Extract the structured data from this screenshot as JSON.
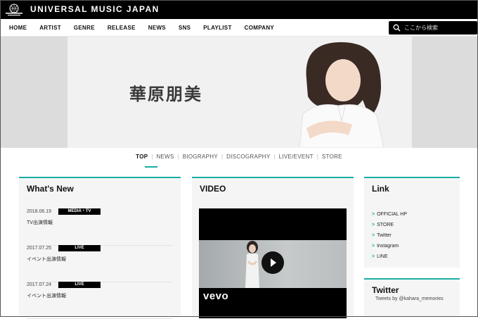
{
  "brand": {
    "name": "UNIVERSAL MUSIC JAPAN",
    "logo_text": "UNIVERSAL"
  },
  "nav": {
    "items": [
      {
        "label": "HOME"
      },
      {
        "label": "ARTIST"
      },
      {
        "label": "GENRE"
      },
      {
        "label": "RELEASE"
      },
      {
        "label": "NEWS"
      },
      {
        "label": "SNS"
      },
      {
        "label": "PLAYLIST"
      },
      {
        "label": "COMPANY"
      }
    ]
  },
  "search": {
    "placeholder": "ここから検索",
    "icon": "search-icon"
  },
  "hero": {
    "artist_name": "華原朋美"
  },
  "subnav": {
    "items": [
      {
        "label": "TOP"
      },
      {
        "label": "NEWS"
      },
      {
        "label": "BIOGRAPHY"
      },
      {
        "label": "DISCOGRAPHY"
      },
      {
        "label": "LIVE/EVENT"
      },
      {
        "label": "STORE"
      }
    ],
    "active": "TOP"
  },
  "whats_new": {
    "title": "What's New",
    "items": [
      {
        "date": "2018.06.19",
        "badge": "MEDIA・TV",
        "title": "TV出演情報"
      },
      {
        "date": "2017.07.25",
        "badge": "LIVE",
        "title": "イベント出演情報"
      },
      {
        "date": "2017.07.24",
        "badge": "LIVE",
        "title": "イベント出演情報"
      }
    ]
  },
  "video": {
    "title": "VIDEO",
    "provider": "vevo"
  },
  "links": {
    "title": "Link",
    "items": [
      {
        "label": "OFFICIAL HP"
      },
      {
        "label": "STORE"
      },
      {
        "label": "Twitter"
      },
      {
        "label": "Instagram"
      },
      {
        "label": "LINE"
      }
    ]
  },
  "twitter": {
    "title": "Twitter",
    "handle_text": "Tweets by @kahara_memories"
  },
  "colors": {
    "accent": "#1aaea5",
    "bar": "#000000",
    "panel": "#f5f5f5"
  }
}
